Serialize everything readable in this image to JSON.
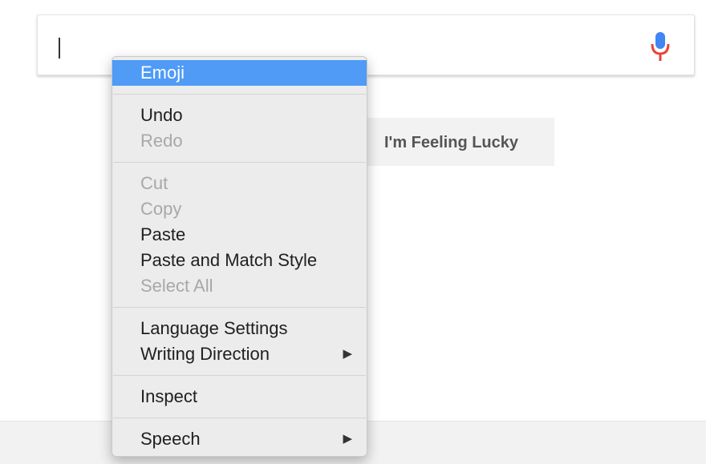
{
  "search": {
    "value": ""
  },
  "buttons": {
    "lucky": "I'm Feeling Lucky"
  },
  "context_menu": {
    "emoji": "Emoji",
    "undo": "Undo",
    "redo": "Redo",
    "cut": "Cut",
    "copy": "Copy",
    "paste": "Paste",
    "paste_match_style": "Paste and Match Style",
    "select_all": "Select All",
    "language_settings": "Language Settings",
    "writing_direction": "Writing Direction",
    "inspect": "Inspect",
    "speech": "Speech",
    "submenu_arrow": "▶"
  },
  "icons": {
    "mic": "microphone-icon",
    "submenu": "triangle-right-icon"
  },
  "colors": {
    "highlight": "#4f9bf6",
    "mic_blue": "#4285f4",
    "mic_red": "#ea4335",
    "disabled_text": "#a8a8a8",
    "button_bg": "#f2f2f2"
  }
}
